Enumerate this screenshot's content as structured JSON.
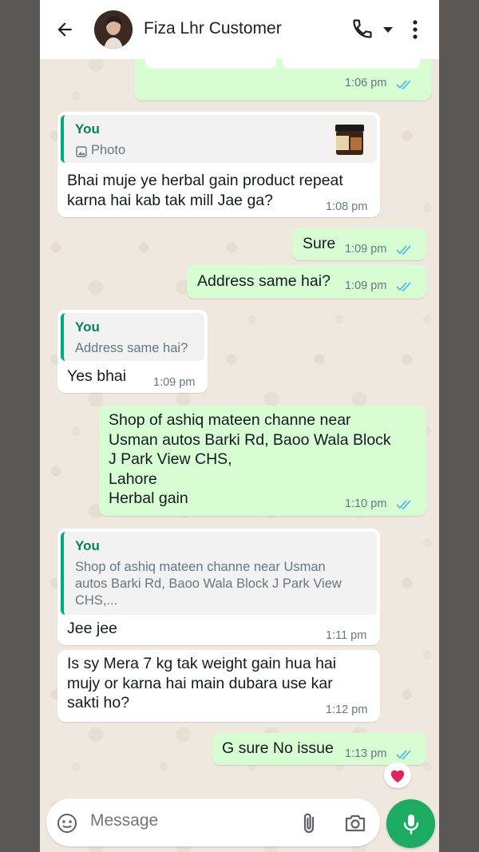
{
  "header": {
    "contact_name": "Fiza Lhr Customer",
    "icons": [
      "back-arrow-icon",
      "phone-icon",
      "chevron-down-icon",
      "more-vertical-icon"
    ]
  },
  "messages": [
    {
      "id": "m0",
      "direction": "out",
      "text": "",
      "time": "1:06 pm",
      "status": "read"
    },
    {
      "id": "m1",
      "direction": "in",
      "quote_author": "You",
      "quote_text": "Photo",
      "quote_has_photo": true,
      "text": "Bhai muje ye herbal gain product repeat\nkarna hai kab tak mill Jae ga?",
      "time": "1:08 pm"
    },
    {
      "id": "m2",
      "direction": "out",
      "text": "Sure",
      "time": "1:09 pm",
      "status": "read"
    },
    {
      "id": "m3",
      "direction": "out",
      "text": "Address same hai?",
      "time": "1:09 pm",
      "status": "read"
    },
    {
      "id": "m4",
      "direction": "in",
      "quote_author": "You",
      "quote_text": "Address same hai?",
      "text": "Yes bhai",
      "time": "1:09 pm"
    },
    {
      "id": "m5",
      "direction": "out",
      "text": "Shop of ashiq mateen channe near\nUsman autos Barki Rd, Baoo Wala Block\nJ Park View CHS,\nLahore\nHerbal gain",
      "time": "1:10 pm",
      "status": "read"
    },
    {
      "id": "m6",
      "direction": "in",
      "quote_author": "You",
      "quote_text": "Shop of ashiq mateen channe near Usman\nautos Barki Rd, Baoo Wala Block J Park View\nCHS,...",
      "text": "Jee jee",
      "time": "1:11 pm"
    },
    {
      "id": "m7",
      "direction": "in",
      "text": "Is sy Mera 7 kg tak weight gain hua hai\nmujy or karna hai main dubara use kar\nsakti ho?",
      "time": "1:12 pm"
    },
    {
      "id": "m8",
      "direction": "out",
      "text": "G sure No issue",
      "time": "1:13 pm",
      "status": "read",
      "reaction": "❤️"
    }
  ],
  "composer": {
    "placeholder": "Message",
    "icons": [
      "emoji-sticker-icon",
      "attach-icon",
      "camera-icon",
      "mic-icon"
    ]
  },
  "colors": {
    "outgoing_bubble": "#d9fdd3",
    "incoming_bubble": "#ffffff",
    "read_ticks": "#53bdeb",
    "quote_bar": "#06a884",
    "quote_author": "#06805f",
    "mic_button": "#1daa61"
  }
}
